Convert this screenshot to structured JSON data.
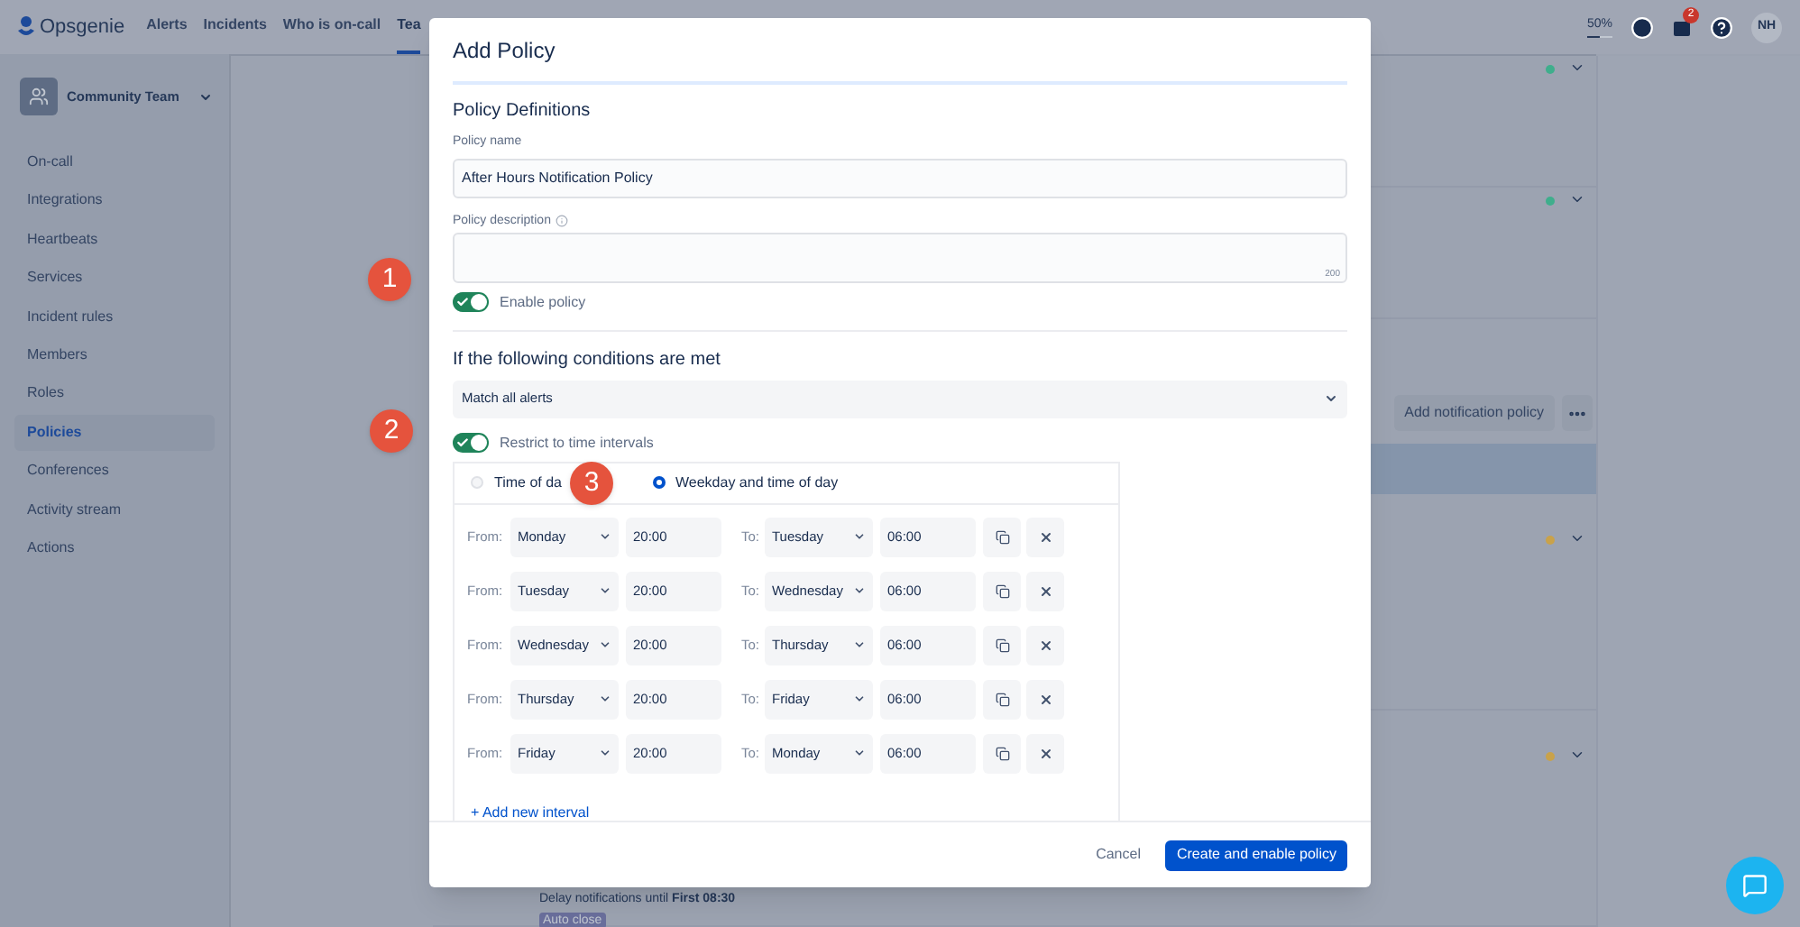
{
  "nav": {
    "logo": "Opsgenie",
    "items": [
      {
        "label": "Alerts",
        "selected": false
      },
      {
        "label": "Incidents",
        "selected": false
      },
      {
        "label": "Who is on-call",
        "selected": false
      },
      {
        "label": "Tea",
        "selected": true
      }
    ],
    "usage": {
      "label": "50%",
      "level": 0.5
    },
    "notification_count": "2",
    "avatar": "NH"
  },
  "sidebar": {
    "team": "Community Team",
    "items": [
      {
        "label": "On-call",
        "selected": false
      },
      {
        "label": "Integrations",
        "selected": false
      },
      {
        "label": "Heartbeats",
        "selected": false
      },
      {
        "label": "Services",
        "selected": false
      },
      {
        "label": "Incident rules",
        "selected": false
      },
      {
        "label": "Members",
        "selected": false
      },
      {
        "label": "Roles",
        "selected": false
      },
      {
        "label": "Policies",
        "selected": true
      },
      {
        "label": "Conferences",
        "selected": false
      },
      {
        "label": "Activity stream",
        "selected": false
      },
      {
        "label": "Actions",
        "selected": false
      }
    ]
  },
  "background": {
    "top_policies": [
      {
        "color": "#3fae8c"
      },
      {
        "color": "#3fae8c"
      }
    ],
    "add_button": "Add notification policy",
    "notification_policies": [
      {
        "color": "#c9a24a"
      },
      {
        "color": "#c9a24a"
      }
    ],
    "delay_text": "Delay notifications until **First 08:30**",
    "auto_close": "Auto close"
  },
  "steps": [
    "1",
    "2",
    "3"
  ],
  "dialog": {
    "title": "Add Policy",
    "section": "Policy Definitions",
    "name_label": "Policy name",
    "name_value": "After Hours Notification Policy",
    "description_label": "Policy description",
    "description_counter": "200",
    "enable": {
      "label": "Enable policy",
      "on": true
    },
    "conditions_heading": "If the following conditions are met",
    "match": "Match all alerts",
    "restrict": {
      "label": "Restrict to time intervals",
      "on": true
    },
    "interval_modes": [
      {
        "label": "Time of da",
        "selected": false
      },
      {
        "label": "Weekday and time of day",
        "selected": true
      }
    ],
    "intervals": [
      {
        "from_label": "From:",
        "from_day": "Monday",
        "from_time": "20:00",
        "to_label": "To:",
        "to_day": "Tuesday",
        "to_time": "06:00"
      },
      {
        "from_label": "From:",
        "from_day": "Tuesday",
        "from_time": "20:00",
        "to_label": "To:",
        "to_day": "Wednesday",
        "to_time": "06:00"
      },
      {
        "from_label": "From:",
        "from_day": "Wednesday",
        "from_time": "20:00",
        "to_label": "To:",
        "to_day": "Thursday",
        "to_time": "06:00"
      },
      {
        "from_label": "From:",
        "from_day": "Thursday",
        "from_time": "20:00",
        "to_label": "To:",
        "to_day": "Friday",
        "to_time": "06:00"
      },
      {
        "from_label": "From:",
        "from_day": "Friday",
        "from_time": "20:00",
        "to_label": "To:",
        "to_day": "Monday",
        "to_time": "06:00"
      }
    ],
    "add_interval": "+ Add new interval",
    "cancel": "Cancel",
    "submit": "Create and enable policy"
  }
}
